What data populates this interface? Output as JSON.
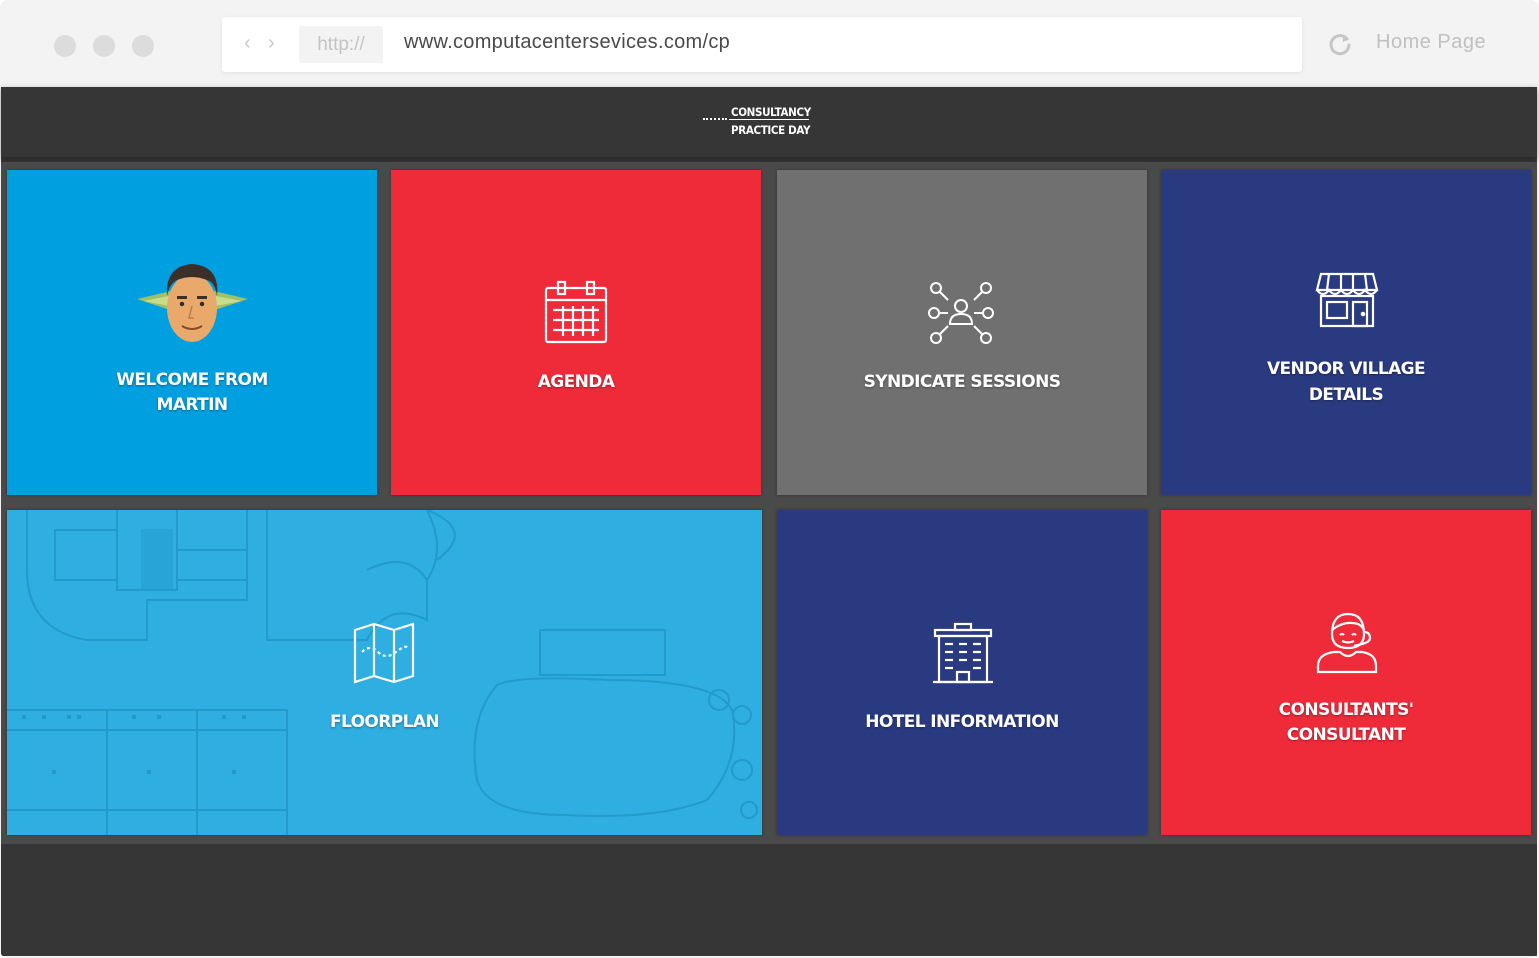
{
  "browser": {
    "protocol": "http://",
    "url": "www.computacentersevices.com/cp",
    "home_label": "Home Page",
    "back_icon": "chevron-left-icon",
    "forward_icon": "chevron-right-icon",
    "reload_icon": "reload-icon"
  },
  "header": {
    "logo_line1": "CONSULTANCY",
    "logo_line2": "PRACTICE DAY"
  },
  "tiles": [
    {
      "line1": "WELCOME FROM",
      "line2": "MARTIN",
      "color": "#009fdf",
      "icon": "martin-avatar-icon"
    },
    {
      "line1": "AGENDA",
      "color": "#ef2b3a",
      "icon": "calendar-icon"
    },
    {
      "line1": "SYNDICATE SESSIONS",
      "color": "#707070",
      "icon": "network-people-icon"
    },
    {
      "line1": "VENDOR VILLAGE",
      "line2": "DETAILS",
      "color": "#2a3a80",
      "icon": "storefront-icon"
    },
    {
      "line1": "FLOORPLAN",
      "color": "#2eaee1",
      "icon": "map-icon"
    },
    {
      "line1": "HOTEL INFORMATION",
      "color": "#2a3a80",
      "icon": "hotel-building-icon"
    },
    {
      "line1": "CONSULTANTS'",
      "line2": "CONSULTANT",
      "color": "#ef2b3a",
      "icon": "consultant-headset-icon"
    }
  ]
}
